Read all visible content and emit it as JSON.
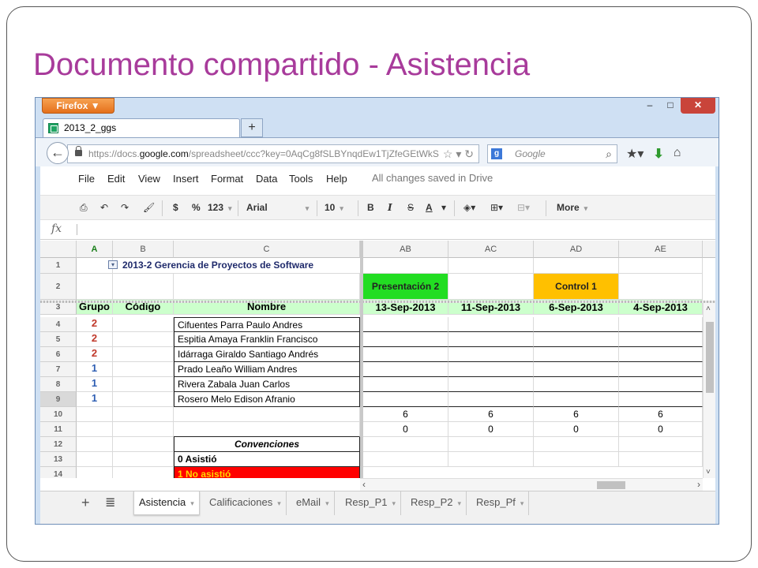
{
  "slide": {
    "title": "Documento compartido - Asistencia"
  },
  "browser": {
    "menu_button": "Firefox ▼",
    "controls": [
      "‒",
      "□",
      "✕"
    ],
    "tab_title": "2013_2_ggs",
    "new_tab": "+",
    "url_prefix": "https://docs.",
    "url_host": "google.com",
    "url_rest": "/spreadsheet/ccc?key=0AqCg8fSLBYnqdEw1TjZfeGEtWkS",
    "search_placeholder": "Google"
  },
  "menus": [
    "File",
    "Edit",
    "View",
    "Insert",
    "Format",
    "Data",
    "Tools",
    "Help"
  ],
  "save_status": "All changes saved in Drive",
  "toolbar": {
    "currency": "$",
    "percent": "%",
    "number_format": "123",
    "font": "Arial",
    "font_size": "10",
    "bold": "B",
    "italic": "I",
    "strike": "S",
    "text_color": "A",
    "more": "More"
  },
  "formula_label": "fx",
  "columns": {
    "A": "A",
    "B": "B",
    "C": "C",
    "AB": "AB",
    "AC": "AC",
    "AD": "AD",
    "AE": "AE"
  },
  "rows": [
    "1",
    "2",
    "3",
    "4",
    "5",
    "6",
    "7",
    "8",
    "9",
    "10",
    "11",
    "12",
    "13",
    "14"
  ],
  "sheet": {
    "title": "2013-2 Gerencia de Proyectos de Software",
    "headers": {
      "grupo": "Grupo",
      "codigo": "Código",
      "nombre": "Nombre"
    },
    "events": {
      "AB": "Presentación 2",
      "AD": "Control 1"
    },
    "dates": {
      "AB": "13-Sep-2013",
      "AC": "11-Sep-2013",
      "AD": "6-Sep-2013",
      "AE": "4-Sep-2013"
    },
    "students": [
      {
        "grupo": "2",
        "nombre": "Cifuentes Parra Paulo Andres"
      },
      {
        "grupo": "2",
        "nombre": "Espitia Amaya Franklin Francisco"
      },
      {
        "grupo": "2",
        "nombre": "Idárraga Giraldo Santiago Andrés"
      },
      {
        "grupo": "1",
        "nombre": "Prado Leaño William Andres"
      },
      {
        "grupo": "1",
        "nombre": "Rivera Zabala Juan Carlos"
      },
      {
        "grupo": "1",
        "nombre": "Rosero Melo Edison Afranio"
      }
    ],
    "row10": {
      "AB": "6",
      "AC": "6",
      "AD": "6",
      "AE": "6"
    },
    "row11": {
      "AB": "0",
      "AC": "0",
      "AD": "0",
      "AE": "0"
    },
    "conventions_title": "Convenciones",
    "conventions": [
      "0 Asistió",
      "1 No asistió"
    ]
  },
  "sheet_tabs": [
    "Asistencia",
    "Calificaciones",
    "eMail",
    "Resp_P1",
    "Resp_P2",
    "Resp_Pf"
  ],
  "colors": {
    "title": "#a83b9b",
    "presentacion": "#22dd22",
    "control": "#ffc000",
    "header_row": "#ccffcc",
    "group_2": "#c0392b",
    "group_1": "#2f5fb3",
    "no_asistio": "#ff0000"
  }
}
